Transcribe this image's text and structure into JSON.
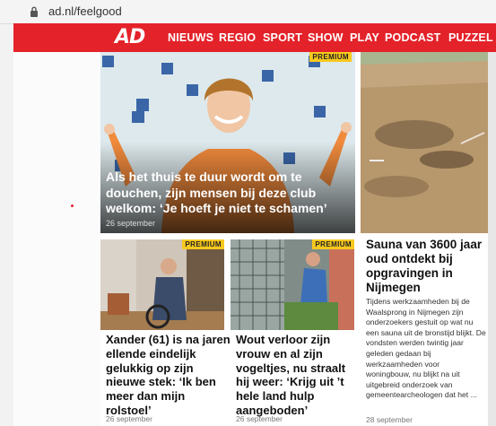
{
  "browser": {
    "url": "ad.nl/feelgood"
  },
  "nav": {
    "logo": "AD",
    "items": [
      "NIEUWS",
      "REGIO",
      "SPORT",
      "SHOW",
      "PLAY",
      "PODCAST",
      "PUZZEL"
    ]
  },
  "hero": {
    "title": "Als het thuis te duur wordt om te douchen, zijn mensen bij deze club welkom: ‘Je hoeft je niet te schamen’",
    "date": "26 september",
    "premium": "PREMIUM"
  },
  "side_article": {
    "title": "Sauna van 3600 jaar oud ontdekt bij opgravingen in Nijmegen",
    "snippet": "Tijdens werkzaamheden bij de Waalsprong in Nijmegen zijn onderzoekers gestuit op wat nu een sauna uit de bronstijd blijkt. De vondsten werden twintig jaar geleden gedaan bij werkzaamheden voor woningbouw, nu blijkt na uit uitgebreid onderzoek van gemeentearcheologen dat het ...",
    "date": "28 september"
  },
  "articles": [
    {
      "premium": "PREMIUM",
      "title": "Xander (61) is na jaren ellende eindelijk gelukkig op zijn nieuwe stek: ‘Ik ben meer dan mijn rolstoel’",
      "date": "26 september"
    },
    {
      "premium": "PREMIUM",
      "title": "Wout verloor zijn vrouw en al zijn vogeltjes, nu straalt hij weer: ‘Krijg uit ’t hele land hulp aangeboden’",
      "date": "26 september"
    }
  ],
  "colors": {
    "brand_red": "#e4222a",
    "premium_yellow": "#f7c81e"
  }
}
